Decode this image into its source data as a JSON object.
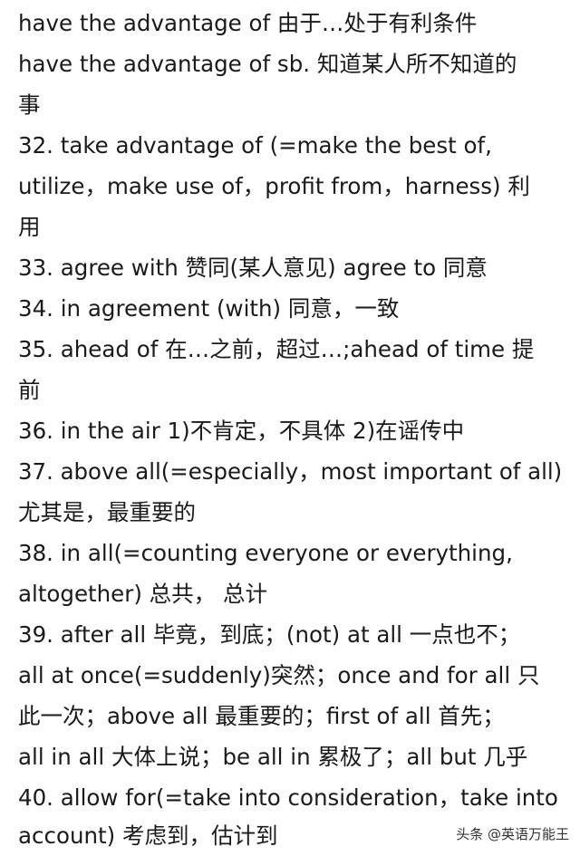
{
  "lines": [
    "have the advantage of 由于…处于有利条件",
    "have the advantage of sb. 知道某人所不知道的",
    "事",
    "32. take advantage of (=make the best of,",
    "utilize，make use of，profit from，harness) 利",
    "用",
    "33. agree with 赞同(某人意见) agree to 同意",
    "34. in agreement (with) 同意，一致",
    "35. ahead of 在…之前，超过…;ahead of time 提",
    "前",
    "36. in the air 1)不肯定，不具体 2)在谣传中",
    "37. above all(=especially，most important of all)",
    "尤其是，最重要的",
    "38. in all(=counting everyone or everything,",
    "altogether) 总共， 总计",
    "39. after all 毕竟，到底；(not) at all 一点也不；",
    "all at once(=suddenly)突然；once and for all 只",
    "此一次；above all 最重要的；first of all 首先；",
    "all in all 大体上说；be all in 累极了；all but 几乎",
    "40. allow for(=take into consideration，take into",
    "account) 考虑到，估计到"
  ],
  "watermark": "头条 @英语万能王"
}
